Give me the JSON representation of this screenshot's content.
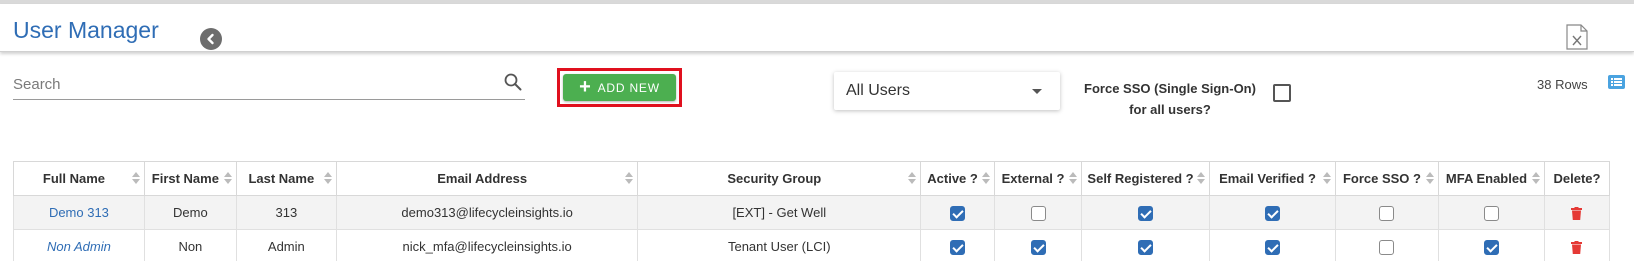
{
  "header": {
    "title": "User Manager"
  },
  "toolbar": {
    "search_placeholder": "Search",
    "search_value": "",
    "add_new_label": "ADD NEW",
    "user_filter_value": "All Users",
    "force_sso_label_line1": "Force SSO (Single Sign-On)",
    "force_sso_label_line2": "for all users?",
    "force_sso_checked": false,
    "rows_count": "38 Rows"
  },
  "table": {
    "columns": [
      "Full Name",
      "First Name",
      "Last Name",
      "Email Address",
      "Security Group",
      "Active ?",
      "External ?",
      "Self Registered ?",
      "Email Verified ?",
      "Force SSO ?",
      "MFA Enabled",
      "Delete?"
    ],
    "rows": [
      {
        "full_name": "Demo 313",
        "first_name": "Demo",
        "last_name": "313",
        "email": "demo313@lifecycleinsights.io",
        "security_group": "[EXT] - Get Well",
        "active": true,
        "external": false,
        "self_registered": true,
        "email_verified": true,
        "force_sso": false,
        "mfa_enabled": false
      },
      {
        "full_name": "Non Admin",
        "first_name": "Non",
        "last_name": "Admin",
        "email": "nick_mfa@lifecycleinsights.io",
        "security_group": "Tenant User (LCI)",
        "active": true,
        "external": true,
        "self_registered": true,
        "email_verified": true,
        "force_sso": false,
        "mfa_enabled": true
      }
    ]
  },
  "colors": {
    "accent": "#2f6db5",
    "add_button": "#4caf50",
    "highlight": "#e0101e",
    "delete": "#e53935"
  },
  "icons": [
    "back-arrow-icon",
    "excel-export-icon",
    "search-icon",
    "plus-icon",
    "dropdown-caret-icon",
    "list-view-icon",
    "sort-icon",
    "trash-icon"
  ]
}
